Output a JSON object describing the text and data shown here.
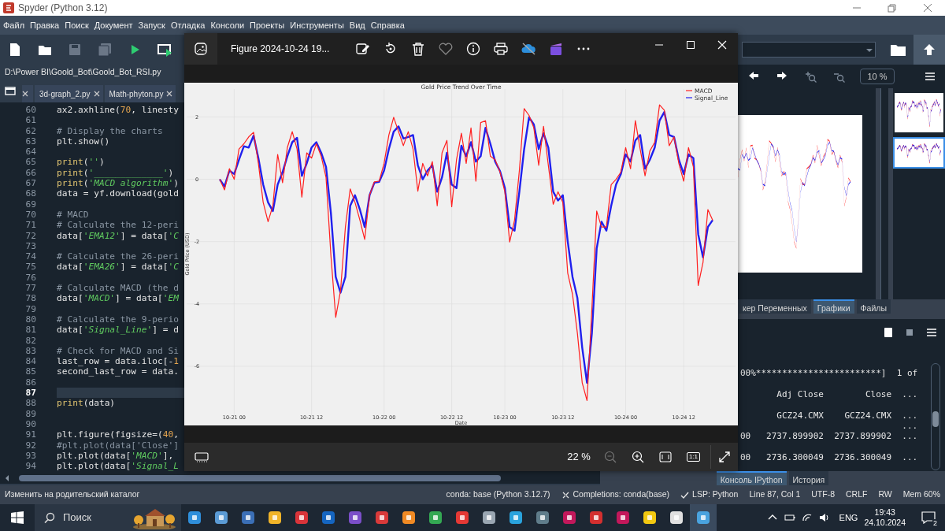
{
  "window": {
    "title": "Spyder (Python 3.12)"
  },
  "menu": [
    "Файл",
    "Правка",
    "Поиск",
    "Документ",
    "Запуск",
    "Отладка",
    "Консоли",
    "Проекты",
    "Инструменты",
    "Вид",
    "Справка"
  ],
  "toolbar_buttons": [
    {
      "disabled": false
    },
    {
      "disabled": false
    },
    {
      "disabled": true
    },
    {
      "disabled": true
    },
    {
      "disabled": false
    },
    {
      "disabled": false
    }
  ],
  "editor": {
    "path": "D:\\Power BI\\Goold_Bot\\Goold_Bot_RSI.py",
    "tabs": [
      {
        "label": "3d-graph_2.py"
      },
      {
        "label": "Math-phyton.py"
      }
    ],
    "lines": [
      {
        "number": "60",
        "code": "ax2.axhline(70, linesty",
        "current": false
      },
      {
        "number": "61",
        "current": false
      },
      {
        "number": "62",
        "code": "# Display the charts",
        "current": false
      },
      {
        "number": "63",
        "code": "plt.show()",
        "current": false
      },
      {
        "number": "64",
        "current": false
      },
      {
        "number": "65",
        "code": "print('')",
        "current": false
      },
      {
        "number": "66",
        "code": "print('_____________')",
        "current": false
      },
      {
        "number": "67",
        "code": "print('MACD algorithm')",
        "current": false
      },
      {
        "number": "68",
        "code": "data = yf.download(gold",
        "current": false
      },
      {
        "number": "69",
        "current": false
      },
      {
        "number": "70",
        "code": "# MACD",
        "current": false
      },
      {
        "number": "71",
        "code": "# Calculate the 12-peri",
        "current": false
      },
      {
        "number": "72",
        "code": "data['EMA12'] = data['C",
        "current": false
      },
      {
        "number": "73",
        "current": false
      },
      {
        "number": "74",
        "code": "# Calculate the 26-peri",
        "current": false
      },
      {
        "number": "75",
        "code": "data['EMA26'] = data['C",
        "current": false
      },
      {
        "number": "76",
        "current": false
      },
      {
        "number": "77",
        "code": "# Calculate MACD (the d",
        "current": false
      },
      {
        "number": "78",
        "code": "data['MACD'] = data['EM",
        "current": false
      },
      {
        "number": "79",
        "current": false
      },
      {
        "number": "80",
        "code": "# Calculate the 9-perio",
        "current": false
      },
      {
        "number": "81",
        "code": "data['Signal_Line'] = d",
        "current": false
      },
      {
        "number": "82",
        "current": false
      },
      {
        "number": "83",
        "code": "# Check for MACD and Si",
        "current": false
      },
      {
        "number": "84",
        "code": "last_row = data.iloc[-1",
        "current": false
      },
      {
        "number": "85",
        "code": "second_last_row = data.",
        "current": false
      },
      {
        "number": "86",
        "current": false
      },
      {
        "number": "87",
        "current": true
      },
      {
        "number": "88",
        "code": "print(data)",
        "current": false
      },
      {
        "number": "89",
        "current": false
      },
      {
        "number": "90",
        "current": false
      },
      {
        "number": "91",
        "code": "plt.figure(figsize=(40,",
        "current": false
      },
      {
        "number": "92",
        "code": "#plt.plot(data['Close']",
        "current": false
      },
      {
        "number": "93",
        "code": "plt.plot(data['MACD'],",
        "current": false
      },
      {
        "number": "94",
        "code": "plt.plot(data['Signal_L",
        "current": false
      }
    ]
  },
  "plots": {
    "zoom": "10 %",
    "tabs": [
      {
        "label": "кер Переменных",
        "selected": false
      },
      {
        "label": "Графики",
        "selected": true
      },
      {
        "label": "Файлы",
        "selected": false
      }
    ],
    "thumbnails": [
      {
        "selected": false
      },
      {
        "selected": true
      }
    ]
  },
  "console": {
    "lines": [
      {
        "kind": "row",
        "text": "00%************************]  1 of"
      },
      {
        "kind": "row",
        "text": "       Adj Close        Close  ..."
      },
      {
        "kind": "row",
        "text": "       GCZ24.CMX    GCZ24.CMX  ..."
      },
      {
        "kind": "dots",
        "text": "                               ..."
      },
      {
        "kind": "row",
        "text": "00   2737.899902  2737.899902  ..."
      },
      {
        "kind": "row",
        "text": "00   2736.300049  2736.300049  ..."
      }
    ],
    "tabs": [
      {
        "label": "Консоль IPython",
        "selected": true
      },
      {
        "label": "История",
        "selected": false
      }
    ]
  },
  "status_bar": {
    "message": "Изменить на родительский каталог",
    "items": [
      {
        "kind": "text",
        "text": "conda: base (Python 3.12.7)"
      },
      {
        "kind": "completions",
        "text": "Completions: conda(base)"
      },
      {
        "kind": "check",
        "text": "LSP: Python"
      },
      {
        "kind": "text",
        "text": "Line 87, Col 1"
      },
      {
        "kind": "text",
        "text": "UTF-8"
      },
      {
        "kind": "text",
        "text": "CRLF"
      },
      {
        "kind": "text",
        "text": "RW"
      },
      {
        "kind": "text",
        "text": "Mem 60%"
      }
    ]
  },
  "viewer": {
    "title": "Figure 2024-10-24 19...",
    "zoom": "22 %",
    "actual_size": "1:1",
    "chart_data": {
      "type": "line",
      "title": "Gold Price Trend Over Time",
      "xlabel": "Date",
      "ylabel": "Gold Price (USD)",
      "categories": [
        null,
        null,
        null,
        "10-21 00",
        null,
        null,
        null,
        null,
        null,
        null,
        null,
        null,
        null,
        null,
        null,
        null,
        null,
        null,
        null,
        "10-21 12",
        null,
        null,
        null,
        null,
        null,
        null,
        null,
        null,
        null,
        null,
        null,
        null,
        null,
        null,
        "10-22 00",
        null,
        null,
        null,
        null,
        null,
        null,
        null,
        null,
        null,
        null,
        null,
        null,
        null,
        "10-22 12",
        null,
        null,
        null,
        null,
        null,
        null,
        null,
        null,
        null,
        null,
        "10-23 00",
        null,
        null,
        null,
        null,
        null,
        null,
        null,
        null,
        null,
        null,
        null,
        "10-23 12",
        null,
        null,
        null,
        null,
        null,
        null,
        null,
        null,
        null,
        null,
        null,
        null,
        "10-24 00",
        null,
        null,
        null,
        null,
        null,
        null,
        null,
        null,
        null,
        null,
        null,
        "10-24 12",
        null,
        null,
        null,
        null,
        null,
        null
      ],
      "series": [
        {
          "name": "MACD",
          "color": "#ff2020",
          "values": [
            0,
            -0.34,
            0.34,
            0,
            0.97,
            1.14,
            1.36,
            1.51,
            0.51,
            -0.74,
            -1.36,
            -0.85,
            0.8,
            -0.11,
            1.02,
            1.53,
            0.97,
            -0.57,
            0.85,
            0.68,
            1.14,
            0.74,
            0.06,
            -2.44,
            -4.43,
            -3.58,
            -1.53,
            -0.31,
            -0.74,
            -1.31,
            -1.93,
            -0.51,
            -0.08,
            -0.06,
            0.51,
            1.42,
            1.99,
            1.53,
            1.08,
            1.53,
            0.97,
            -0.38,
            0.51,
            0.11,
            0.57,
            -0.85,
            0.85,
            1.25,
            -0.88,
            0.63,
            1.48,
            0.51,
            1.65,
            -0.06,
            1.82,
            1.88,
            0.74,
            0.63,
            0.23,
            -0.4,
            -2.01,
            -1.31,
            0.28,
            2.27,
            2.05,
            1.65,
            0.45,
            1.7,
            0.45,
            -0.8,
            -0.4,
            -0.74,
            -3.01,
            -3.69,
            -4.94,
            -6.53,
            -7.1,
            -4.15,
            -1.02,
            -1.53,
            -1.53,
            -0.17,
            0,
            0.23,
            1.02,
            0.34,
            1.88,
            0.97,
            0.11,
            0.91,
            1.19,
            2.39,
            2.22,
            1.08,
            1.36,
            0.51,
            -0.06,
            1.02,
            0.4,
            -3.41,
            -2.67,
            -0.97,
            -1.31
          ]
        },
        {
          "name": "Signal_Line",
          "color": "#2020ee",
          "values": [
            0,
            -0.23,
            0.28,
            0.17,
            0.63,
            1.06,
            1.02,
            1.4,
            0.68,
            -0.17,
            -0.74,
            -1.02,
            -0.17,
            0.23,
            0.74,
            1.19,
            1.33,
            0.11,
            0.51,
            1.02,
            1.19,
            0.85,
            0.4,
            -1.08,
            -3.13,
            -3.64,
            -3.13,
            -0.85,
            -0.51,
            -0.97,
            -1.53,
            -0.51,
            -0.11,
            -0.08,
            0.28,
            0.97,
            1.53,
            1.7,
            1.31,
            1.36,
            1.42,
            0.45,
            0,
            0.28,
            0.45,
            -0.4,
            0.06,
            0.85,
            -0.17,
            -0.28,
            1.08,
            0.74,
            1.19,
            0.57,
            0.74,
            1.65,
            1.14,
            0.57,
            0.26,
            -0.28,
            -1.53,
            -1.65,
            -0.4,
            0.97,
            1.99,
            1.76,
            0.97,
            1.48,
            1.02,
            -0.4,
            -0.68,
            -0.51,
            -1.99,
            -3.13,
            -3.81,
            -5.4,
            -6.53,
            -4.94,
            -2.22,
            -1.36,
            -1.65,
            -0.85,
            -0.17,
            0.17,
            0.8,
            0.57,
            1.25,
            1.42,
            0.34,
            0.63,
            1.02,
            1.88,
            2.16,
            1.42,
            1.36,
            0.63,
            0.17,
            0.8,
            0.68,
            -1.76,
            -2.5,
            -1.53,
            -1.31
          ]
        }
      ],
      "ylim": [
        -7.9,
        3.1
      ],
      "grid": true,
      "legend": true,
      "yticks": [
        2,
        0,
        -2,
        -4,
        -6
      ]
    }
  },
  "taskbar": {
    "search_placeholder": "Поиск",
    "apps": [
      {
        "active": false
      },
      {
        "active": false
      },
      {
        "active": false
      },
      {
        "active": false
      },
      {
        "active": false
      },
      {
        "active": false
      },
      {
        "active": false
      },
      {
        "active": false
      },
      {
        "active": false
      },
      {
        "active": false
      },
      {
        "active": false
      },
      {
        "active": false
      },
      {
        "active": false
      },
      {
        "active": false
      },
      {
        "active": false
      },
      {
        "active": false
      },
      {
        "active": false
      },
      {
        "active": false
      },
      {
        "active": false
      },
      {
        "active": true
      }
    ],
    "language": "ENG",
    "time": "19:43",
    "date": "24.10.2024",
    "notifications": "2"
  }
}
